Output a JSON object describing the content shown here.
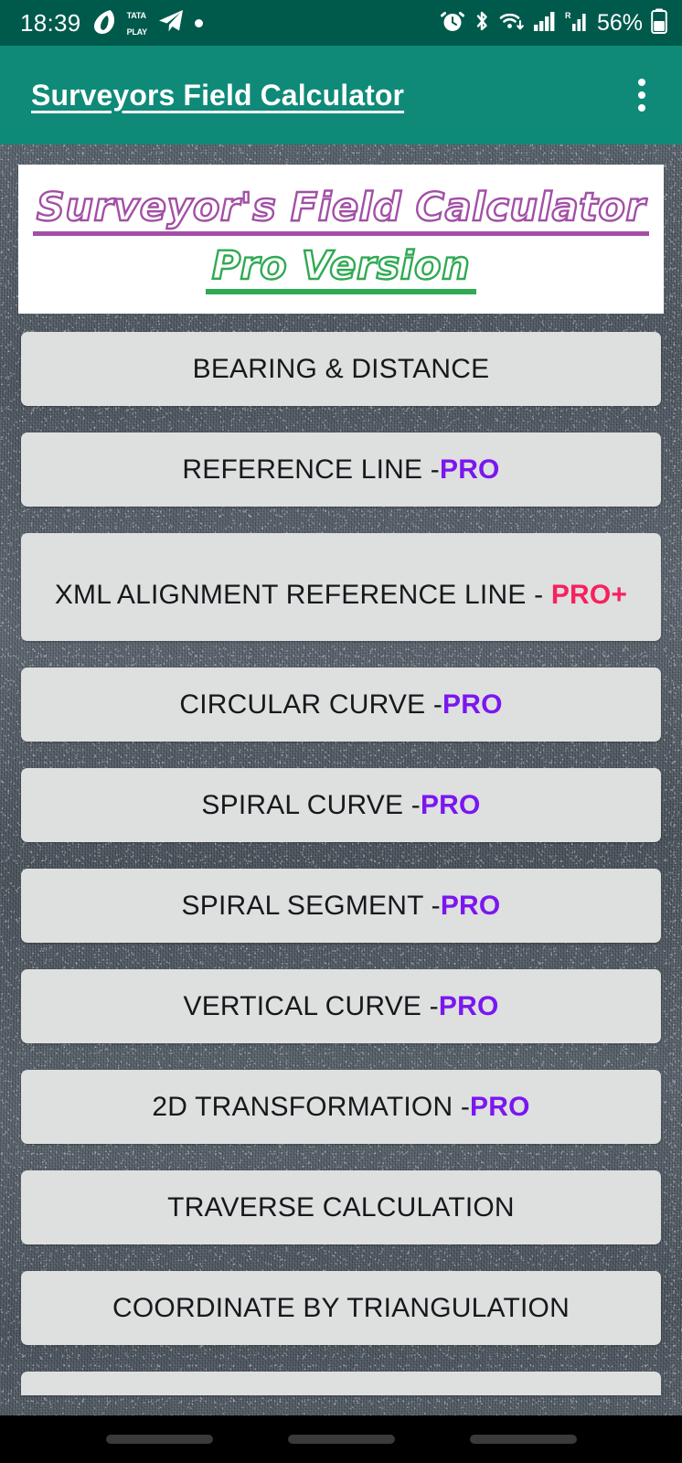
{
  "status_bar": {
    "time": "18:39",
    "carrier_icon": "airtel-logo-icon",
    "tata_play_line1": "TATA",
    "tata_play_line2": "PLAY",
    "telegram_icon": "telegram-icon",
    "dot_icon": "dot-icon",
    "alarm_icon": "alarm-icon",
    "bluetooth_icon": "bluetooth-icon",
    "wifi_icon": "wifi-icon",
    "signal_icon": "signal-bars-icon",
    "roaming_signal_icon": "roaming-signal-icon",
    "battery_percent": "56%",
    "battery_icon": "battery-icon",
    "background_color": "#005a4c"
  },
  "app_bar": {
    "title": "Surveyors Field Calculator",
    "overflow_icon": "overflow-menu-icon",
    "background_color": "#0f8a78",
    "title_color": "#ffffff"
  },
  "banner": {
    "line1": "Surveyor's Field Calculator",
    "line2": "Pro Version",
    "line1_color": "#a24fa6",
    "line2_color": "#2faa52",
    "background_color": "#ffffff"
  },
  "menu": {
    "button_background": "#dedfdf",
    "pro_color": "#7b16f0",
    "pro_plus_color": "#f6215e",
    "items": [
      {
        "label": "BEARING & DISTANCE",
        "badge": "",
        "badge_type": "none",
        "lines": 1
      },
      {
        "label": "REFERENCE LINE - ",
        "badge": "PRO",
        "badge_type": "pro",
        "lines": 1
      },
      {
        "label": "XML ALIGNMENT REFERENCE LINE - ",
        "badge": "PRO+",
        "badge_type": "proplus",
        "lines": 2
      },
      {
        "label": "CIRCULAR CURVE - ",
        "badge": "PRO",
        "badge_type": "pro",
        "lines": 1
      },
      {
        "label": "SPIRAL CURVE - ",
        "badge": "PRO",
        "badge_type": "pro",
        "lines": 1
      },
      {
        "label": "SPIRAL SEGMENT - ",
        "badge": "PRO",
        "badge_type": "pro",
        "lines": 1
      },
      {
        "label": "VERTICAL CURVE - ",
        "badge": "PRO",
        "badge_type": "pro",
        "lines": 1
      },
      {
        "label": "2D TRANSFORMATION - ",
        "badge": "PRO",
        "badge_type": "pro",
        "lines": 1
      },
      {
        "label": "TRAVERSE CALCULATION",
        "badge": "",
        "badge_type": "none",
        "lines": 1
      },
      {
        "label": "COORDINATE BY TRIANGULATION",
        "badge": "",
        "badge_type": "none",
        "lines": 1
      },
      {
        "label": "",
        "badge": "",
        "badge_type": "none",
        "lines": 1,
        "clipped": true
      }
    ]
  },
  "nav_bar": {
    "recents_label": "recents-button",
    "home_label": "home-button",
    "back_label": "back-button",
    "background_color": "#000000"
  }
}
